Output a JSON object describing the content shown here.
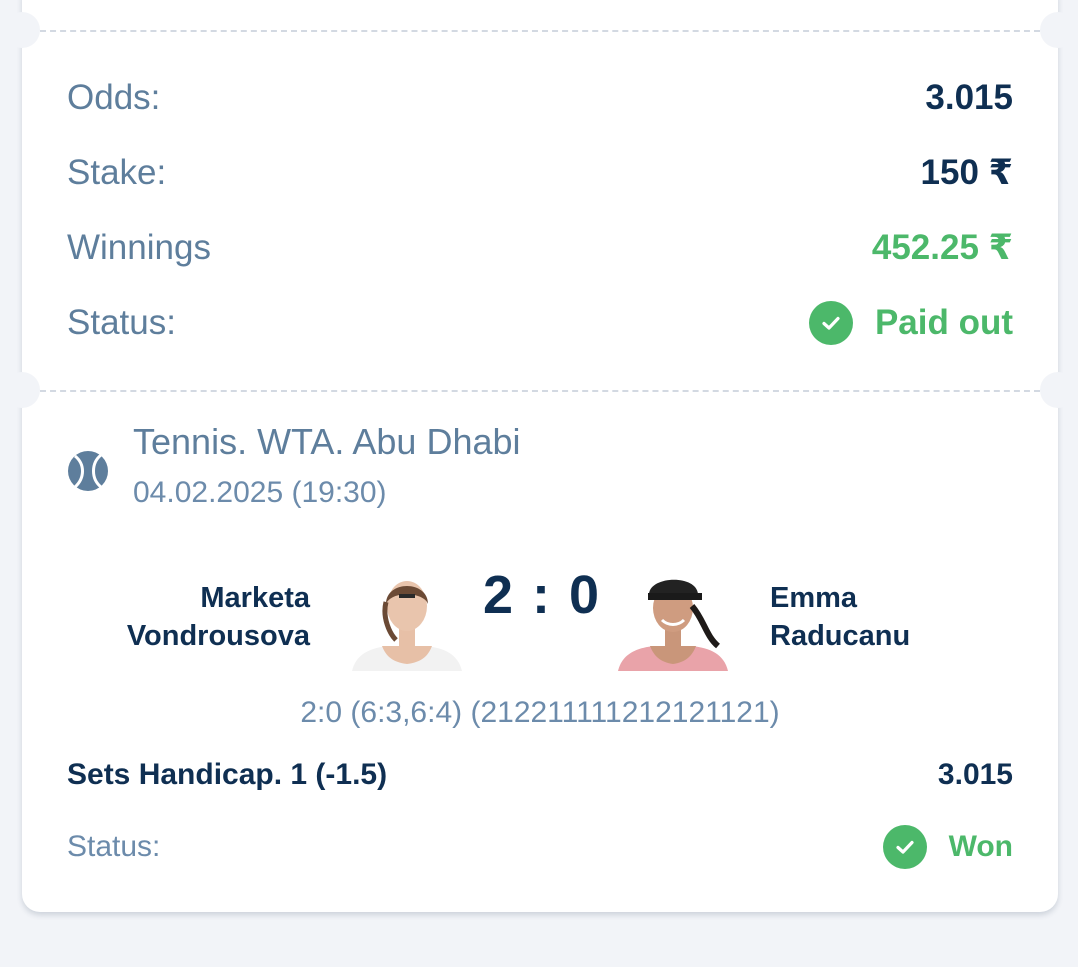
{
  "summary": {
    "odds_label": "Odds:",
    "odds_value": "3.015",
    "stake_label": "Stake:",
    "stake_value": "150 ₹",
    "winnings_label": "Winnings",
    "winnings_value": "452.25 ₹",
    "status_label": "Status:",
    "status_value": "Paid out"
  },
  "event": {
    "title": "Tennis. WTA. Abu Dhabi",
    "date": "04.02.2025 (19:30)",
    "icon": "tennis-ball-icon",
    "player1": {
      "first": "Marketa",
      "last": "Vondrousova"
    },
    "player2": {
      "first": "Emma",
      "last": "Raducanu"
    },
    "score": "2 : 0",
    "score_detail": "2:0 (6:3,6:4) (212211111212121121)",
    "market": "Sets Handicap. 1 (-1.5)",
    "market_odds": "3.015",
    "status_label": "Status:",
    "status_value": "Won"
  },
  "colors": {
    "accent_green": "#4cb86a",
    "text_dark": "#0f2f52",
    "text_muted": "#5e7e9c",
    "background": "#f2f4f8"
  }
}
